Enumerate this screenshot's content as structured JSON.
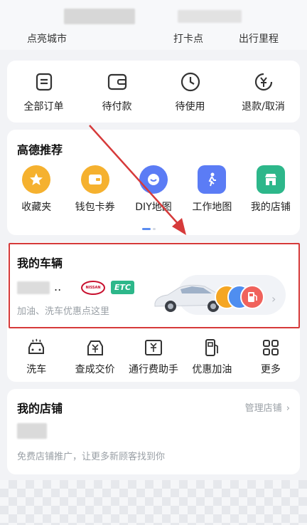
{
  "top_stats": {
    "lit_cities": "点亮城市",
    "check_in": "打卡点",
    "mileage": "出行里程"
  },
  "orders": [
    {
      "label": "全部订单",
      "icon": "order-list-icon"
    },
    {
      "label": "待付款",
      "icon": "wallet-icon"
    },
    {
      "label": "待使用",
      "icon": "clock-icon"
    },
    {
      "label": "退款/取消",
      "icon": "refund-yuan-icon"
    }
  ],
  "recommend": {
    "title": "高德推荐",
    "items": [
      {
        "label": "收藏夹",
        "icon": "star-icon",
        "color": "#f5a623"
      },
      {
        "label": "钱包卡券",
        "icon": "wallet-card-icon",
        "color": "#f5a623"
      },
      {
        "label": "DIY地图",
        "icon": "diy-map-icon",
        "color": "#5b7cf5"
      },
      {
        "label": "工作地图",
        "icon": "walker-icon",
        "color": "#5b7cf5"
      },
      {
        "label": "我的店铺",
        "icon": "shop-icon",
        "color": "#2db78a"
      }
    ]
  },
  "vehicle": {
    "title": "我的车辆",
    "plate_suffix": "..",
    "brand_badge": "NISSAN",
    "etc_badge": "ETC",
    "subtitle": "加油、洗车优惠点这里"
  },
  "services": [
    {
      "label": "洗车",
      "icon": "car-wash-icon"
    },
    {
      "label": "查成交价",
      "icon": "price-tag-icon"
    },
    {
      "label": "通行费助手",
      "icon": "toll-icon"
    },
    {
      "label": "优惠加油",
      "icon": "fuel-icon"
    },
    {
      "label": "更多",
      "icon": "more-grid-icon"
    }
  ],
  "store": {
    "title": "我的店铺",
    "manage": "管理店铺",
    "subtitle": "免费店铺推广，让更多新顾客找到你"
  },
  "colors": {
    "accent_blue": "#5a8cf0",
    "highlight_red": "#d63a3a",
    "etc_green": "#2db78a",
    "nissan_red": "#c8102e"
  }
}
